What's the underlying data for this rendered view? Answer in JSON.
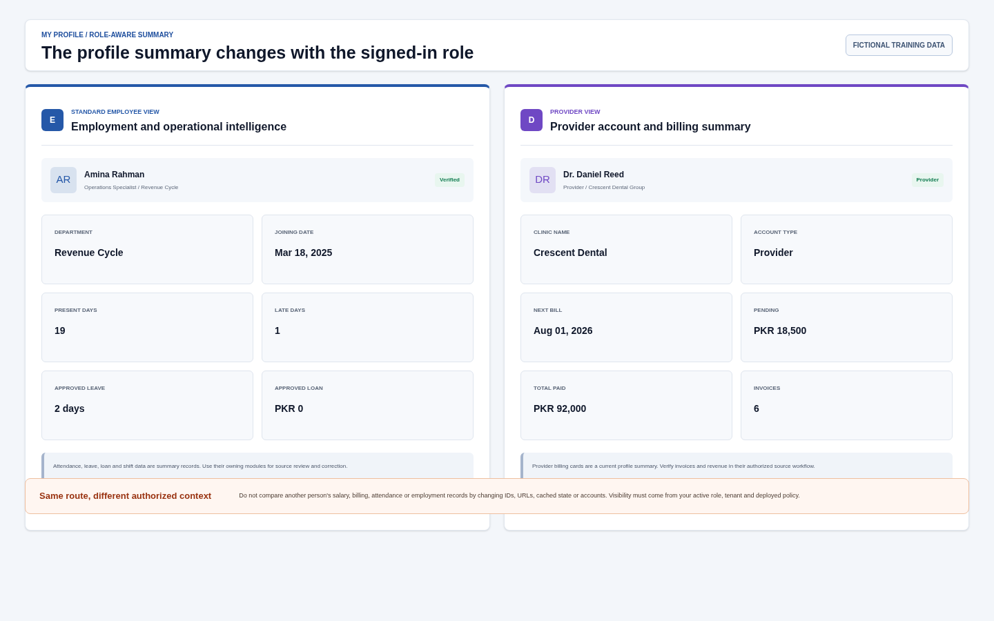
{
  "header": {
    "breadcrumb": "MY PROFILE / ROLE-AWARE SUMMARY",
    "title": "The profile summary changes with the signed-in role",
    "badge": "FICTIONAL TRAINING DATA"
  },
  "panels": [
    {
      "color": "#2558a8",
      "icon_letter": "E",
      "eyebrow": "STANDARD EMPLOYEE VIEW",
      "title": "Employment and operational intelligence",
      "profile": {
        "initials": "AR",
        "name": "Amina Rahman",
        "subtitle": "Operations Specialist / Revenue Cycle",
        "tag": "Verified"
      },
      "stats": [
        {
          "label": "DEPARTMENT",
          "value": "Revenue Cycle"
        },
        {
          "label": "JOINING DATE",
          "value": "Mar 18, 2025"
        },
        {
          "label": "PRESENT DAYS",
          "value": "19"
        },
        {
          "label": "LATE DAYS",
          "value": "1"
        },
        {
          "label": "APPROVED LEAVE",
          "value": "2 days"
        },
        {
          "label": "APPROVED LOAN",
          "value": "PKR 0"
        }
      ],
      "note": "Attendance, leave, loan and shift data are summary records. Use their owning modules for source review and correction."
    },
    {
      "color": "#6f48c4",
      "icon_letter": "D",
      "eyebrow": "PROVIDER VIEW",
      "title": "Provider account and billing summary",
      "profile": {
        "initials": "DR",
        "name": "Dr. Daniel Reed",
        "subtitle": "Provider / Crescent Dental Group",
        "tag": "Provider"
      },
      "stats": [
        {
          "label": "CLINIC NAME",
          "value": "Crescent Dental"
        },
        {
          "label": "ACCOUNT TYPE",
          "value": "Provider"
        },
        {
          "label": "NEXT BILL",
          "value": "Aug 01, 2026"
        },
        {
          "label": "PENDING",
          "value": "PKR 18,500"
        },
        {
          "label": "TOTAL PAID",
          "value": "PKR 92,000"
        },
        {
          "label": "INVOICES",
          "value": "6"
        }
      ],
      "note": "Provider billing cards are a current profile summary. Verify invoices and revenue in their authorized source workflow."
    }
  ],
  "warning": {
    "title": "Same route, different authorized context",
    "text": "Do not compare another person's salary, billing, attendance or employment records by changing IDs, URLs, cached state or accounts. Visibility must come from your active role, tenant and deployed policy."
  }
}
